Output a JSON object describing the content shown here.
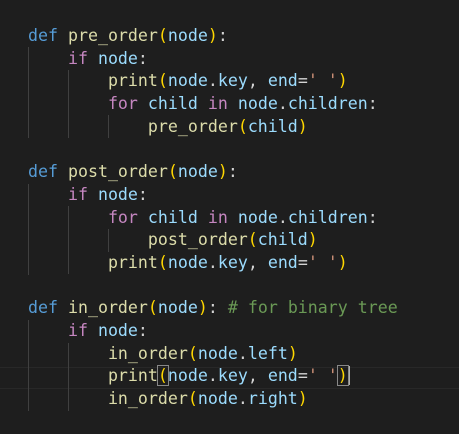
{
  "editor": {
    "background": "#1e1e1e",
    "cursor_line": 16,
    "colors": {
      "keyword_def": "#569cd6",
      "function": "#dcdcaa",
      "paren": "#ffd700",
      "variable": "#9cdcfe",
      "control_keyword": "#c586c0",
      "string": "#ce9178",
      "comment": "#6a9955",
      "plain": "#d4d4d4"
    },
    "tokens": {
      "def": "def",
      "if": "if",
      "for": "for",
      "in": "in",
      "node": "node",
      "child": "child",
      "children": "children",
      "key": "key",
      "end": "end",
      "print": "print",
      "space_str": "' '",
      "left": "left",
      "right": "right",
      "fn_pre": "pre_order",
      "fn_post": "post_order",
      "fn_in": "in_order",
      "comment": "# for binary tree"
    }
  }
}
